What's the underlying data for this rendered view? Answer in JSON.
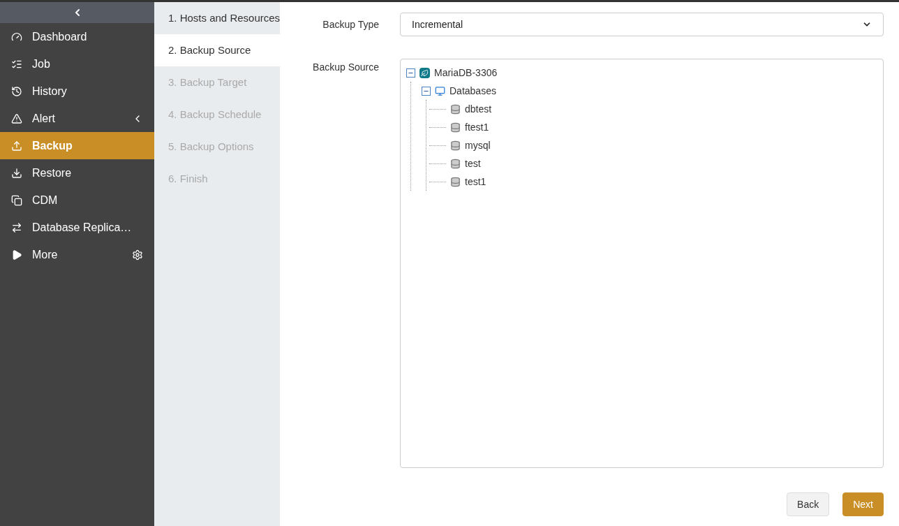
{
  "sidebar": {
    "items": [
      {
        "label": "Dashboard",
        "kind": "dashboard",
        "selected": false
      },
      {
        "label": "Job",
        "kind": "job",
        "selected": false
      },
      {
        "label": "History",
        "kind": "history",
        "selected": false
      },
      {
        "label": "Alert",
        "kind": "alert",
        "selected": false,
        "expanded": false
      },
      {
        "label": "Backup",
        "kind": "backup",
        "selected": true
      },
      {
        "label": "Restore",
        "kind": "restore",
        "selected": false
      },
      {
        "label": "CDM",
        "kind": "cdm",
        "selected": false
      },
      {
        "label": "Database Replica…",
        "kind": "replication",
        "selected": false
      },
      {
        "label": "More",
        "kind": "more",
        "selected": false
      }
    ]
  },
  "steps": [
    {
      "label": "1. Hosts and Resources",
      "selected": false,
      "disabled": false
    },
    {
      "label": "2. Backup Source",
      "selected": true,
      "disabled": false
    },
    {
      "label": "3. Backup Target",
      "selected": false,
      "disabled": true
    },
    {
      "label": "4. Backup Schedule",
      "selected": false,
      "disabled": true
    },
    {
      "label": "5. Backup Options",
      "selected": false,
      "disabled": true
    },
    {
      "label": "6. Finish",
      "selected": false,
      "disabled": true
    }
  ],
  "form": {
    "backup_type": {
      "label": "Backup Type",
      "value": "Incremental"
    },
    "backup_source": {
      "label": "Backup Source",
      "tree": [
        {
          "label": "MariaDB-3306",
          "kind": "instance",
          "expanded": true,
          "children": [
            {
              "label": "Databases",
              "kind": "folder",
              "expanded": true,
              "children": [
                {
                  "label": "dbtest",
                  "kind": "database"
                },
                {
                  "label": "ftest1",
                  "kind": "database"
                },
                {
                  "label": "mysql",
                  "kind": "database"
                },
                {
                  "label": "test",
                  "kind": "database"
                },
                {
                  "label": "test1",
                  "kind": "database"
                }
              ]
            }
          ]
        }
      ]
    }
  },
  "buttons": [
    {
      "label": "Back",
      "kind": "secondary"
    },
    {
      "label": "Next",
      "kind": "primary"
    }
  ]
}
